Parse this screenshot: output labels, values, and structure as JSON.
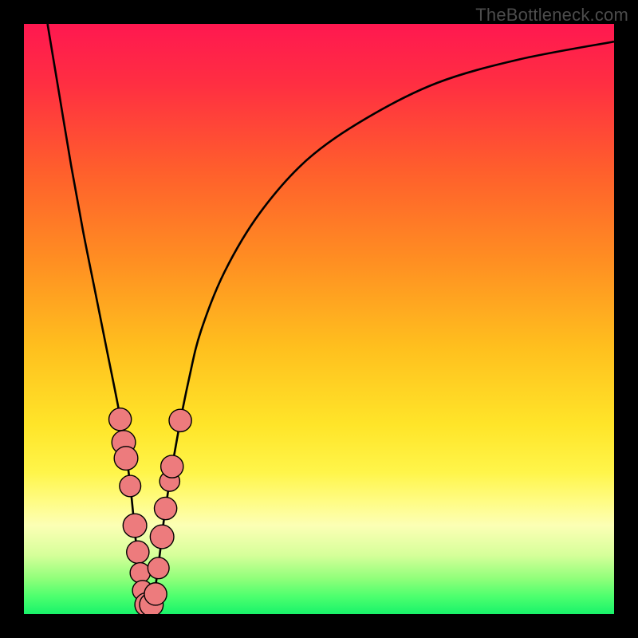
{
  "watermark": {
    "text": "TheBottleneck.com"
  },
  "colors": {
    "frame": "#000000",
    "curve": "#000000",
    "marker_fill": "#ed7b7d",
    "marker_stroke": "#000000",
    "gradient_stops": [
      {
        "offset": "0%",
        "color": "#ff1850"
      },
      {
        "offset": "10%",
        "color": "#ff2e42"
      },
      {
        "offset": "25%",
        "color": "#ff5f2c"
      },
      {
        "offset": "40%",
        "color": "#ff8e22"
      },
      {
        "offset": "55%",
        "color": "#ffc01e"
      },
      {
        "offset": "68%",
        "color": "#ffe529"
      },
      {
        "offset": "76%",
        "color": "#fff54a"
      },
      {
        "offset": "81%",
        "color": "#fffc85"
      },
      {
        "offset": "85%",
        "color": "#fcffb5"
      },
      {
        "offset": "90%",
        "color": "#d6ff9a"
      },
      {
        "offset": "94%",
        "color": "#90ff7a"
      },
      {
        "offset": "97%",
        "color": "#4dff6e"
      },
      {
        "offset": "100%",
        "color": "#19f36a"
      }
    ]
  },
  "chart_data": {
    "type": "line",
    "title": "",
    "xlabel": "",
    "ylabel": "",
    "xlim": [
      0,
      100
    ],
    "ylim": [
      0,
      100
    ],
    "series": [
      {
        "name": "bottleneck-curve",
        "x": [
          4,
          6,
          8,
          10,
          12,
          14,
          16,
          17,
          18,
          19,
          20,
          21,
          22,
          23,
          24,
          26,
          28,
          30,
          34,
          40,
          48,
          58,
          70,
          84,
          100
        ],
        "y": [
          100,
          88,
          76,
          65,
          55,
          45,
          35,
          29,
          22,
          12,
          3,
          1,
          3,
          10,
          18,
          30,
          40,
          48,
          58,
          68,
          77,
          84,
          90,
          94,
          97
        ]
      }
    ],
    "markers": {
      "name": "highlighted-points",
      "points": [
        {
          "x": 16.3,
          "y": 33.0,
          "r": 1.5
        },
        {
          "x": 16.9,
          "y": 29.1,
          "r": 1.6
        },
        {
          "x": 17.3,
          "y": 26.4,
          "r": 1.6
        },
        {
          "x": 18.0,
          "y": 21.7,
          "r": 1.4
        },
        {
          "x": 18.8,
          "y": 15.0,
          "r": 1.6
        },
        {
          "x": 19.3,
          "y": 10.5,
          "r": 1.5
        },
        {
          "x": 19.7,
          "y": 7.0,
          "r": 1.3
        },
        {
          "x": 20.1,
          "y": 4.0,
          "r": 1.3
        },
        {
          "x": 20.8,
          "y": 1.6,
          "r": 1.6
        },
        {
          "x": 21.6,
          "y": 1.6,
          "r": 1.6
        },
        {
          "x": 22.3,
          "y": 3.4,
          "r": 1.5
        },
        {
          "x": 22.8,
          "y": 7.8,
          "r": 1.4
        },
        {
          "x": 23.4,
          "y": 13.1,
          "r": 1.6
        },
        {
          "x": 24.0,
          "y": 17.9,
          "r": 1.5
        },
        {
          "x": 24.7,
          "y": 22.5,
          "r": 1.3
        },
        {
          "x": 25.1,
          "y": 25.0,
          "r": 1.5
        },
        {
          "x": 26.5,
          "y": 32.8,
          "r": 1.5
        }
      ]
    }
  }
}
